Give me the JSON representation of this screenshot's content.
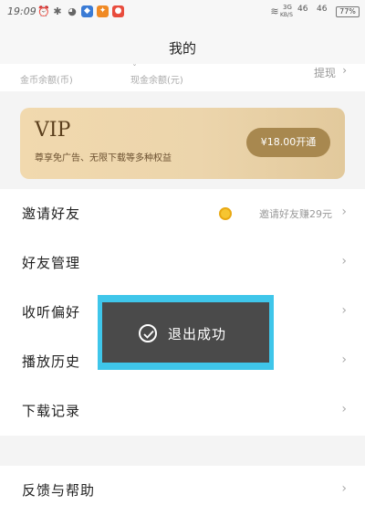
{
  "status_bar": {
    "time": "19:09",
    "network_label": "3G",
    "network_sub": "KB/S",
    "signal_1": "46",
    "signal_2": "46",
    "battery": "77%"
  },
  "header": {
    "title": "我的"
  },
  "balances": {
    "coin_label": "金币余额(币)",
    "cash_label": "现金余额(元)",
    "withdraw_label": "提现"
  },
  "vip": {
    "title": "VIP",
    "subtitle": "尊享免广告、无限下载等多种权益",
    "button_label": "¥18.00开通"
  },
  "menu": {
    "items": [
      {
        "label": "邀请好友",
        "extra": "邀请好友赚29元"
      },
      {
        "label": "好友管理"
      },
      {
        "label": "收听偏好"
      },
      {
        "label": "播放历史"
      },
      {
        "label": "下载记录"
      }
    ],
    "feedback_label": "反馈与帮助"
  },
  "toast": {
    "text": "退出成功"
  },
  "icons": {
    "chevron": "chevron-right-icon",
    "coin": "coin-icon",
    "check": "check-circle-icon"
  },
  "colors": {
    "vip_gold": "#e9d3a8",
    "vip_button": "#a8884f",
    "toast_bg": "#4a4a4a",
    "toast_border": "#3fc6ea"
  }
}
